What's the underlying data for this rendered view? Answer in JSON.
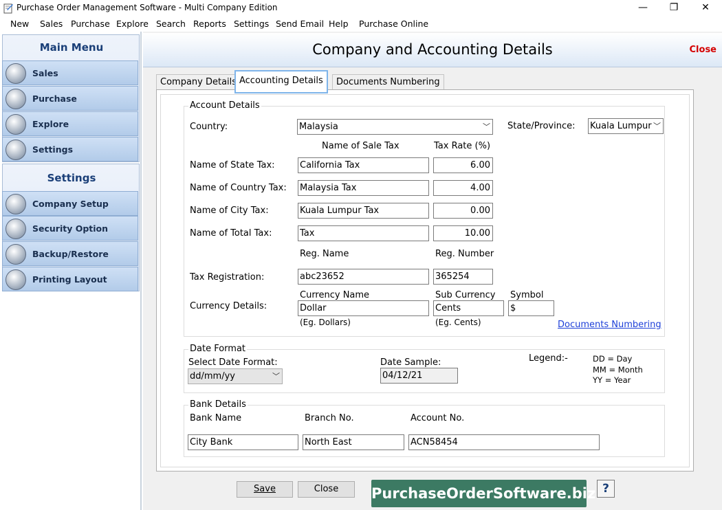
{
  "window": {
    "title": "Purchase Order Management Software - Multi Company Edition",
    "minimize_glyph": "—",
    "maximize_glyph": "❐",
    "close_glyph": "✕"
  },
  "menu": [
    "New",
    "Sales",
    "Purchase",
    "Explore",
    "Search",
    "Reports",
    "Settings",
    "Send Email",
    "Help",
    "Purchase Online"
  ],
  "sidebar": {
    "main_menu_title": "Main Menu",
    "main_items": [
      "Sales",
      "Purchase",
      "Explore",
      "Settings"
    ],
    "settings_title": "Settings",
    "settings_items": [
      "Company Setup",
      "Security Option",
      "Backup/Restore",
      "Printing Layout"
    ]
  },
  "header": {
    "title": "Company and Accounting Details",
    "close_label": "Close"
  },
  "tabs": [
    "Company Details",
    "Accounting Details",
    "Documents Numbering"
  ],
  "account": {
    "group_label": "Account Details",
    "country_label": "Country:",
    "country_value": "Malaysia",
    "state_label": "State/Province:",
    "state_value": "Kuala Lumpur",
    "col_tax_name": "Name of Sale Tax",
    "col_tax_rate": "Tax Rate (%)",
    "taxes": [
      {
        "label": "Name of State Tax:",
        "name": "California Tax",
        "rate": "6.00"
      },
      {
        "label": "Name of Country Tax:",
        "name": "Malaysia Tax",
        "rate": "4.00"
      },
      {
        "label": "Name of City Tax:",
        "name": "Kuala Lumpur Tax",
        "rate": "0.00"
      },
      {
        "label": "Name of Total Tax:",
        "name": "Tax",
        "rate": "10.00"
      }
    ],
    "reg_name_header": "Reg. Name",
    "reg_number_header": "Reg. Number",
    "tax_reg_label": "Tax Registration:",
    "reg_name_value": "abc23652",
    "reg_number_value": "365254",
    "currency_label": "Currency Details:",
    "currency_name_header": "Currency Name",
    "sub_currency_header": "Sub Currency",
    "symbol_header": "Symbol",
    "currency_name_value": "Dollar",
    "sub_currency_value": "Cents",
    "symbol_value": "$",
    "currency_hint": "(Eg. Dollars)",
    "sub_currency_hint": "(Eg. Cents)",
    "documents_link": "Documents Numbering"
  },
  "date": {
    "group_label": "Date Format",
    "select_label": "Select Date Format:",
    "format_value": "dd/mm/yy",
    "sample_label": "Date Sample:",
    "sample_value": "04/12/21",
    "legend_label": "Legend:-",
    "legend_items": [
      "DD = Day",
      "MM = Month",
      "YY = Year"
    ]
  },
  "bank": {
    "group_label": "Bank Details",
    "name_header": "Bank Name",
    "branch_header": "Branch No.",
    "account_header": "Account No.",
    "name_value": "City Bank",
    "branch_value": "North East",
    "account_value": "ACN58454"
  },
  "footer": {
    "save_label": "Save",
    "close_label": "Close",
    "brand": "PurchaseOrderSoftware.biz",
    "help_glyph": "?"
  }
}
